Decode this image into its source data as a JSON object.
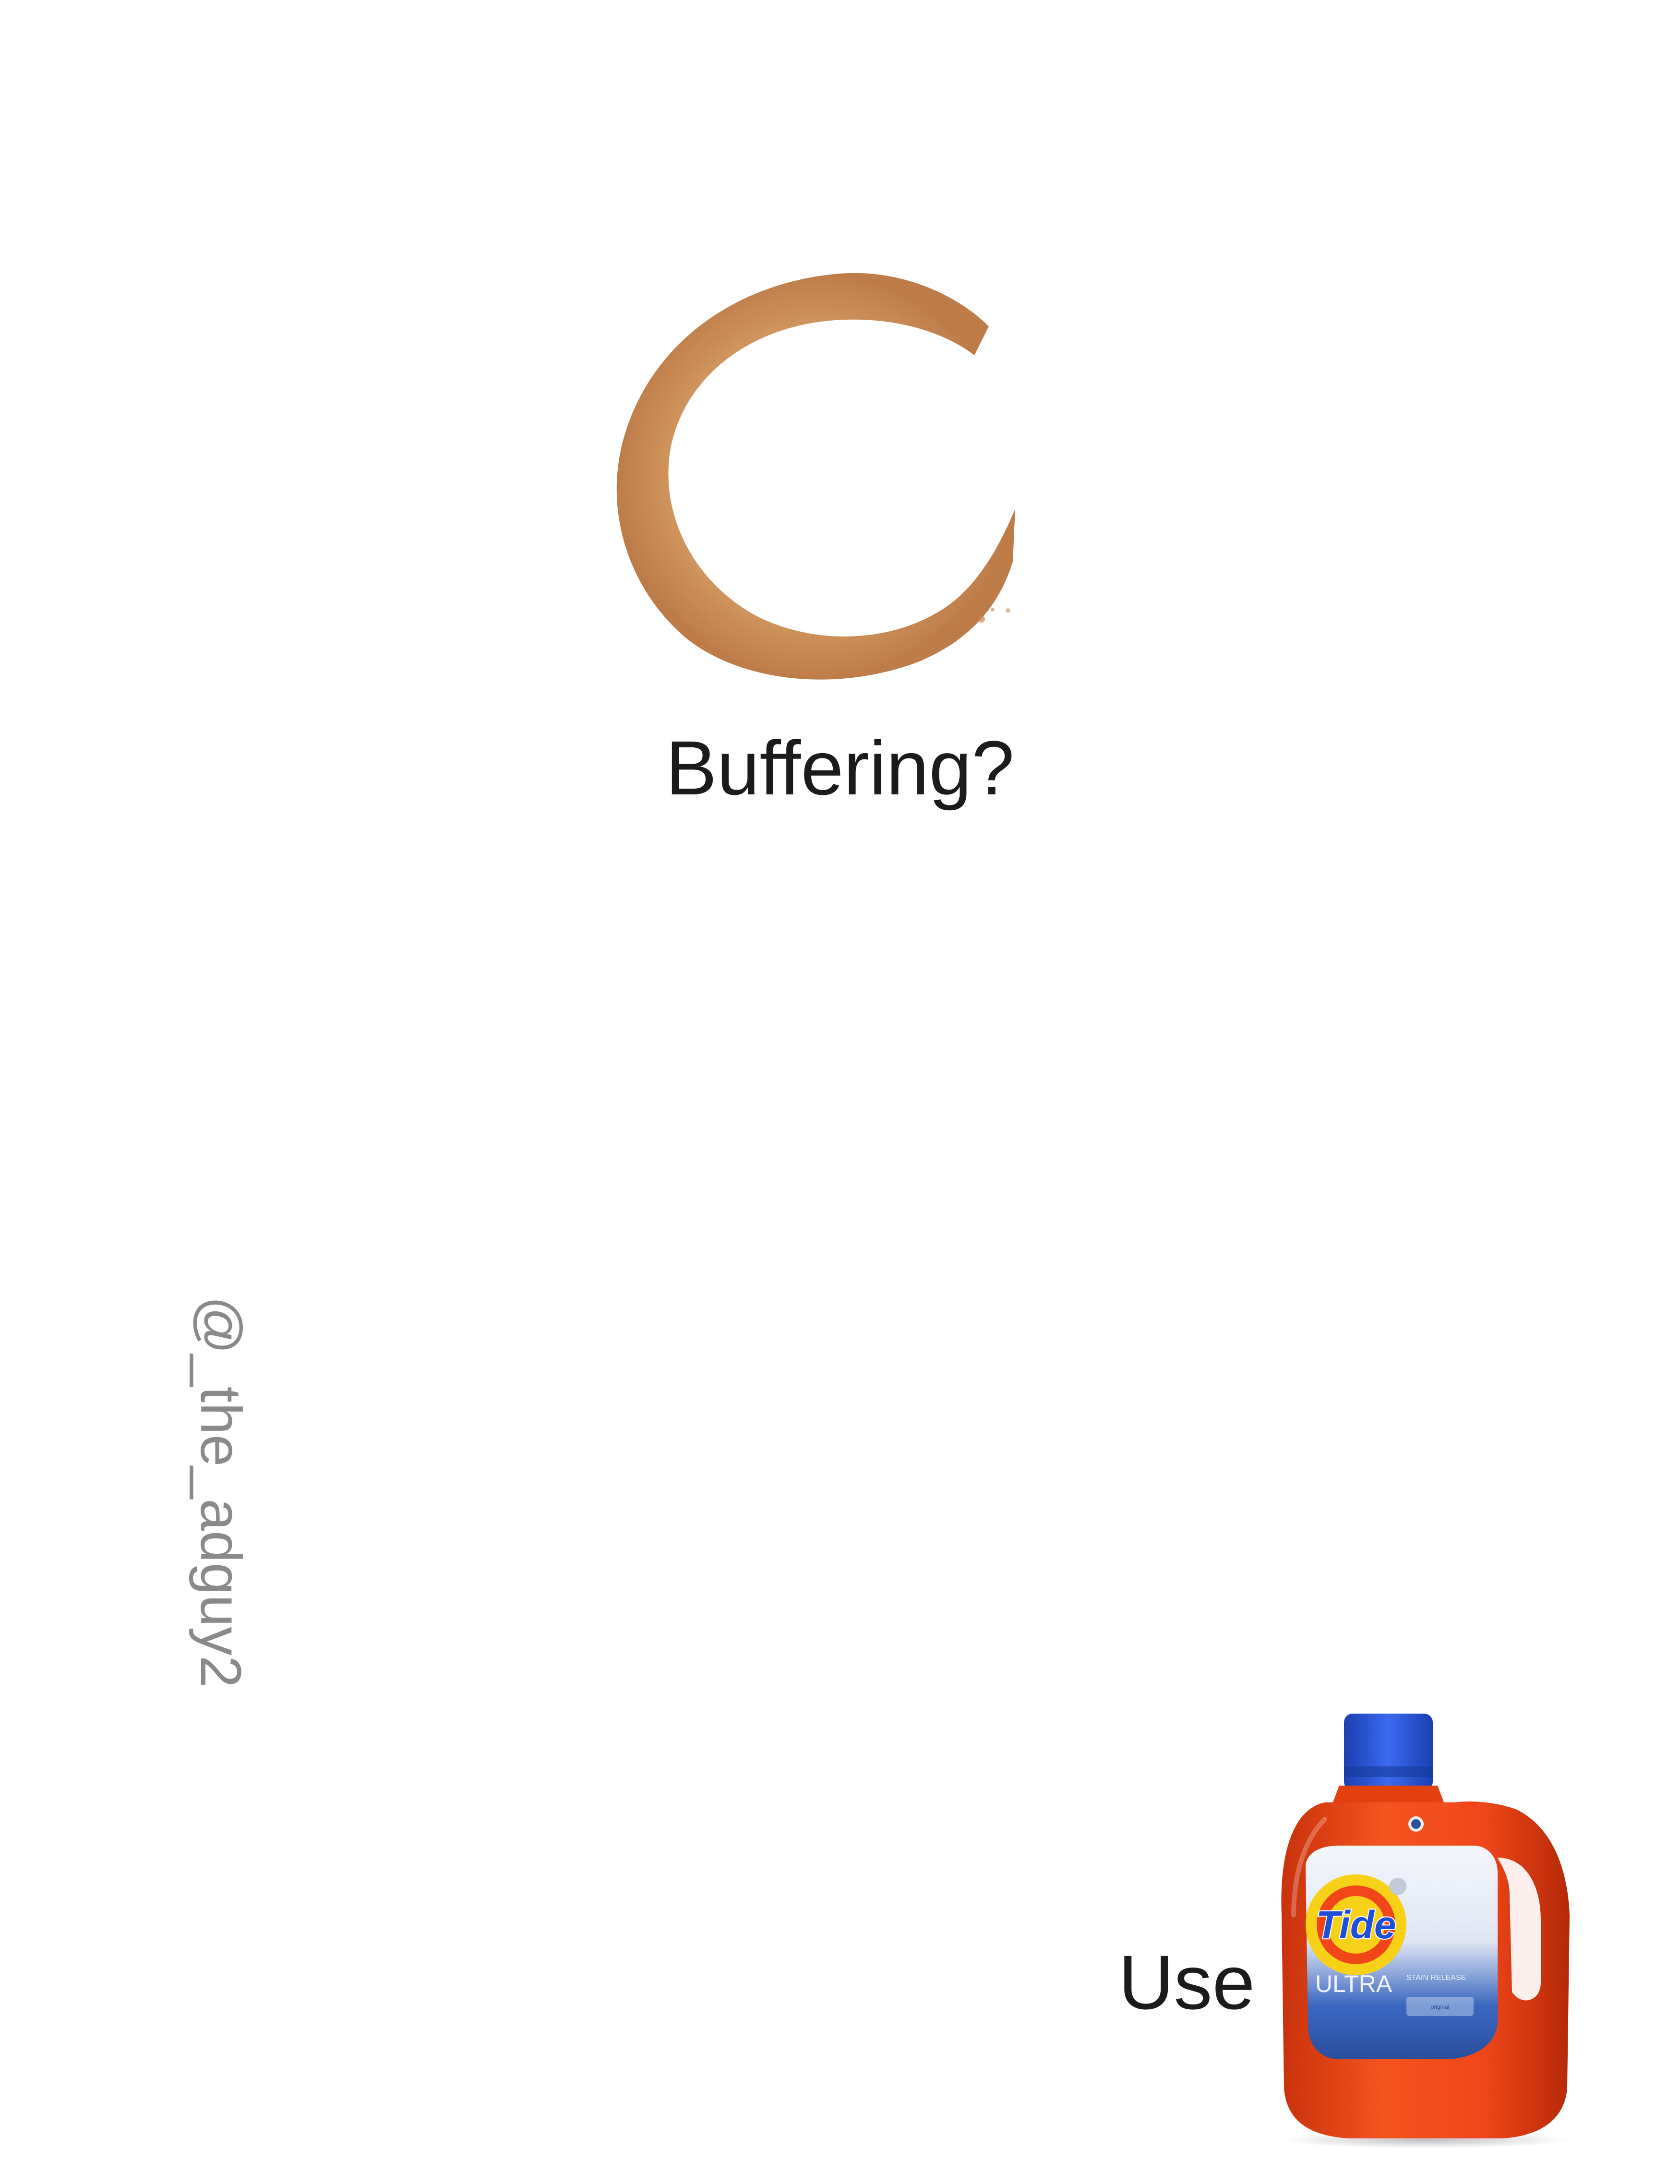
{
  "headline": "Buffering?",
  "handle": "@_the_adguy2",
  "cta": {
    "label": "Use"
  },
  "product": {
    "brand_logo_text": "Tide",
    "line_text": "ULTRA",
    "sub_text": "STAIN RELEASE",
    "variant_text": "original",
    "colors": {
      "bottle": "#f0461a",
      "cap": "#1f4ed8",
      "label_blue": "#2f5fb8",
      "logo_yellow": "#f7d117"
    }
  },
  "stain_color": "#c9864a"
}
